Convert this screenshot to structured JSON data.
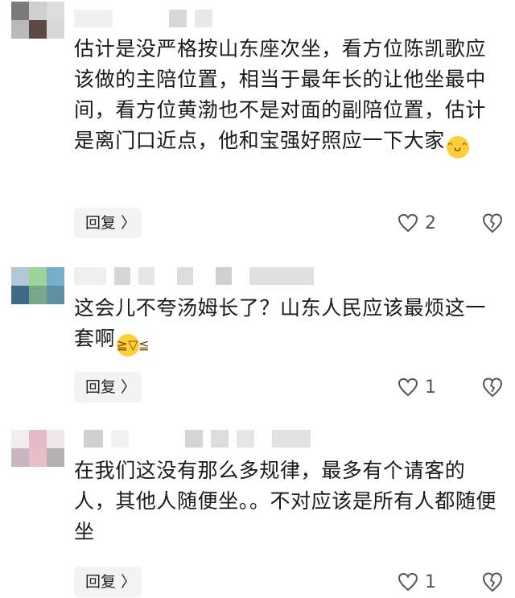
{
  "comments": [
    {
      "text": "估计是没严格按山东座次坐，看方位陈凯歌应该做的主陪位置，相当于最年长的让他坐最中间，看方位黄渤也不是对面的副陪位置，估计是离门口近点，他和宝强好照应一下大家",
      "emoji": "grinning-face-emoji",
      "reply_label": "回复 〉",
      "like_count": "2",
      "avatar_colors": [
        "#7a7a7a",
        "#cfcfcf",
        "#dcdcdc",
        "#b9b9b9",
        "#5a4a42",
        "#d8d8d8"
      ]
    },
    {
      "text": "这会儿不夸汤姆长了？山东人民应该最烦这一套啊",
      "emoji": "crying-laughing-emoji",
      "reply_label": "回复 〉",
      "like_count": "1",
      "avatar_colors": [
        "#b3c6d6",
        "#9bd39a",
        "#76aeca",
        "#3e6b88",
        "#78a88a",
        "#5f8fa3"
      ]
    },
    {
      "text": "在我们这没有那么多规律，最多有个请客的人，其他人随便坐。。不对应该是所有人都随便坐",
      "emoji": "",
      "reply_label": "回复 〉",
      "like_count": "1",
      "avatar_colors": [
        "#f2ecef",
        "#e6b9c6",
        "#efe7ea",
        "#c7b6bd",
        "#e9bcc8",
        "#b5b0b2"
      ]
    }
  ],
  "colors": {
    "reply_bg": "#f3f3f3",
    "icon": "#555555",
    "blur": "#e4e4e4"
  }
}
